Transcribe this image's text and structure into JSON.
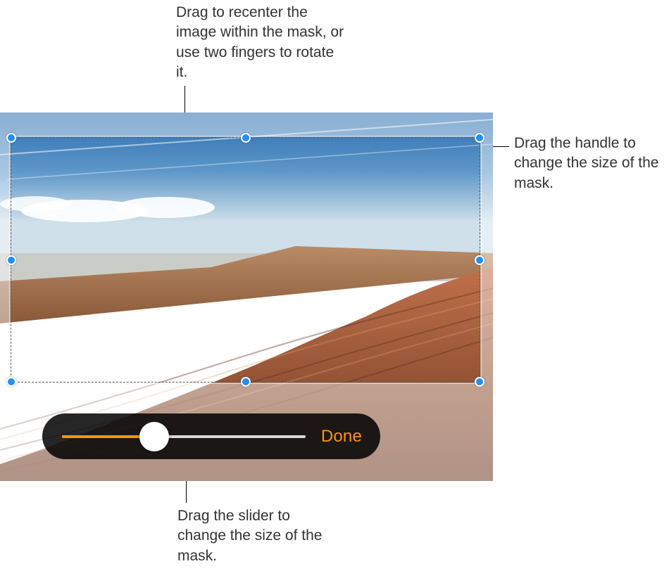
{
  "callouts": {
    "top": "Drag to recenter the image within the mask, or use two fingers to rotate it.",
    "right": "Drag the handle to change the size of the mask.",
    "bottom": "Drag the slider to change the size of the mask."
  },
  "controls": {
    "done_label": "Done",
    "slider_fill_percent": 38
  },
  "colors": {
    "accent": "#ff9500",
    "handle": "#1e8fff"
  }
}
